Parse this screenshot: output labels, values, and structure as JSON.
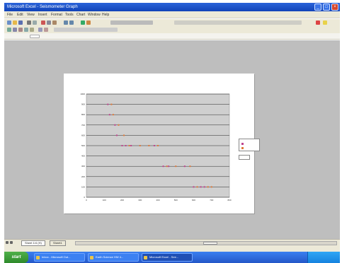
{
  "window": {
    "title": "Microsoft Excel - Seismometer Graph",
    "minimize": "_",
    "maximize": "□",
    "close": "×"
  },
  "menu": [
    "File",
    "Edit",
    "View",
    "Insert",
    "Format",
    "Tools",
    "Chart",
    "Window",
    "Help"
  ],
  "sheet_tabs": [
    "Sheet 1/4 (H)",
    "Sheet1"
  ],
  "taskbar": {
    "start": "start",
    "tasks": [
      "Inbox - Microsoft Out...",
      "Earth Science HW 4...",
      "Microsoft Excel - See..."
    ],
    "clock": ""
  },
  "colors": {
    "series_p": "#c0448f",
    "series_s": "#e07a3a",
    "gridline": "#000000",
    "plot_bg": "#cfcfcf"
  },
  "chart_data": {
    "type": "scatter",
    "title": "",
    "xlabel": "",
    "ylabel": "",
    "xlim": [
      0,
      800
    ],
    "ylim": [
      0,
      1000
    ],
    "x_ticks": [
      0,
      100,
      200,
      300,
      400,
      500,
      600,
      700,
      800
    ],
    "y_ticks": [
      0,
      100,
      200,
      300,
      400,
      500,
      600,
      700,
      800,
      900,
      1000
    ],
    "series": [
      {
        "values": [
          [
            120,
            900
          ],
          [
            130,
            800
          ],
          [
            160,
            700
          ],
          [
            170,
            600
          ],
          [
            200,
            500
          ],
          [
            220,
            500
          ],
          [
            250,
            500
          ],
          [
            380,
            500
          ],
          [
            430,
            300
          ],
          [
            460,
            300
          ],
          [
            550,
            300
          ],
          [
            600,
            100
          ],
          [
            640,
            100
          ],
          [
            660,
            100
          ]
        ]
      },
      {
        "values": [
          [
            140,
            900
          ],
          [
            150,
            800
          ],
          [
            180,
            700
          ],
          [
            210,
            600
          ],
          [
            240,
            500
          ],
          [
            300,
            500
          ],
          [
            350,
            500
          ],
          [
            400,
            500
          ],
          [
            450,
            300
          ],
          [
            500,
            300
          ],
          [
            580,
            300
          ],
          [
            620,
            100
          ],
          [
            680,
            100
          ],
          [
            700,
            100
          ]
        ]
      }
    ],
    "legend_position": "right"
  }
}
